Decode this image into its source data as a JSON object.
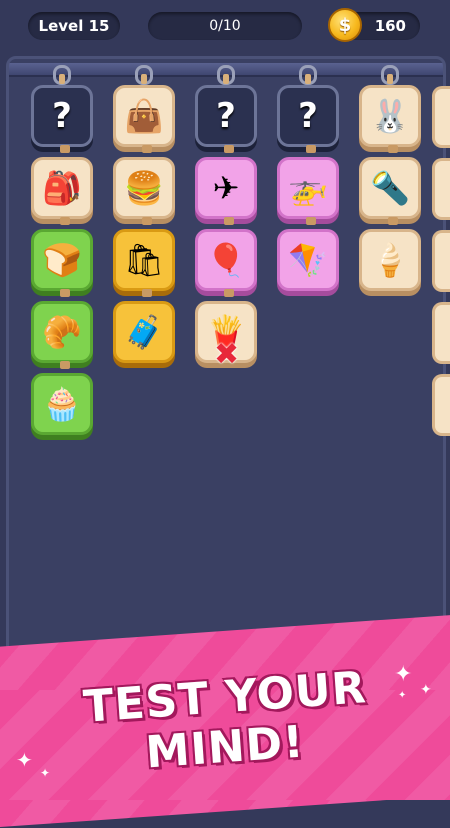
{
  "hud": {
    "level_label": "Level 15",
    "progress_text": "0/10",
    "coin_symbol": "$",
    "coins": "160"
  },
  "board": {
    "columns": [
      {
        "tiles": [
          {
            "kind": "hidden",
            "icon": "?",
            "icon_name": "question-icon"
          },
          {
            "kind": "cream",
            "icon": "🎒",
            "icon_name": "backpack-icon"
          },
          {
            "kind": "green",
            "icon": "🍞",
            "icon_name": "bread-icon"
          },
          {
            "kind": "green",
            "icon": "🥐",
            "icon_name": "croissant-icon"
          },
          {
            "kind": "green",
            "icon": "🧁",
            "icon_name": "muffin-icon"
          }
        ]
      },
      {
        "tiles": [
          {
            "kind": "cream",
            "icon": "👜",
            "icon_name": "handbag-icon"
          },
          {
            "kind": "cream",
            "icon": "🍔",
            "icon_name": "burger-icon"
          },
          {
            "kind": "orange",
            "icon": "🛍",
            "icon_name": "tote-bag-icon"
          },
          {
            "kind": "orange",
            "icon": "🧳",
            "icon_name": "suitcase-icon"
          }
        ]
      },
      {
        "tiles": [
          {
            "kind": "hidden",
            "icon": "?",
            "icon_name": "question-icon"
          },
          {
            "kind": "pink",
            "icon": "✈",
            "icon_name": "airplane-icon"
          },
          {
            "kind": "pink",
            "icon": "🎈",
            "icon_name": "hot-air-balloon-icon"
          },
          {
            "kind": "cream",
            "icon": "🍟",
            "icon_name": "fries-icon",
            "blocked": true
          }
        ]
      },
      {
        "tiles": [
          {
            "kind": "hidden",
            "icon": "?",
            "icon_name": "question-icon"
          },
          {
            "kind": "pink",
            "icon": "🚁",
            "icon_name": "helicopter-icon"
          },
          {
            "kind": "pink",
            "icon": "🪁",
            "icon_name": "kite-icon"
          }
        ]
      },
      {
        "tiles": [
          {
            "kind": "cream",
            "icon": "🐰",
            "icon_name": "bunny-icon"
          },
          {
            "kind": "cream",
            "icon": "🔦",
            "icon_name": "flashlight-icon"
          },
          {
            "kind": "cream",
            "icon": "🍦",
            "icon_name": "ice-cream-icon"
          }
        ]
      }
    ],
    "blocked_mark": "✖"
  },
  "banner": {
    "line1": "TEST YOUR",
    "line2": "MIND!"
  },
  "colors": {
    "background": "#34395a",
    "banner_pink": "#ef4b9a",
    "coin_gold": "#f7b91e"
  }
}
